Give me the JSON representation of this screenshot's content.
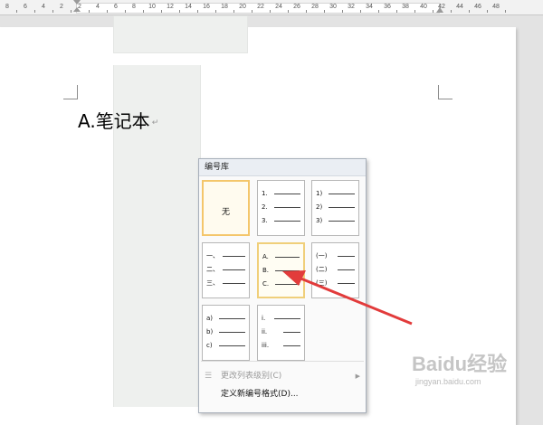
{
  "ruler": {
    "labels": [
      "8",
      "6",
      "4",
      "2",
      "2",
      "4",
      "6",
      "8",
      "10",
      "12",
      "14",
      "16",
      "18",
      "20",
      "22",
      "24",
      "26",
      "28",
      "30",
      "32",
      "34",
      "36",
      "38",
      "40",
      "42",
      "44",
      "46",
      "48"
    ]
  },
  "document": {
    "line_text": "A.笔记本",
    "paragraph_mark": "↵"
  },
  "numbering_library": {
    "title": "编号库",
    "none_label": "无",
    "styles": [
      {
        "markers": [
          "1.",
          "2.",
          "3."
        ]
      },
      {
        "markers": [
          "1)",
          "2)",
          "3)"
        ]
      },
      {
        "markers": [
          "一、",
          "二、",
          "三、"
        ]
      },
      {
        "markers": [
          "A.",
          "B.",
          "C."
        ]
      },
      {
        "markers": [
          "(一)",
          "(二)",
          "(三)"
        ]
      },
      {
        "markers": [
          "a)",
          "b)",
          "c)"
        ]
      },
      {
        "markers": [
          "i.",
          "ii.",
          "iii."
        ]
      }
    ],
    "change_level_label": "更改列表级别(C)",
    "define_new_format_label": "定义新编号格式(D)..."
  },
  "icons": {
    "change_level": "indent-list-icon",
    "submenu": "chevron-right-icon"
  },
  "colors": {
    "selected_border": "#f4c66b",
    "annotation_arrow": "#e23b3b"
  },
  "watermark": {
    "logo": "Baidu经验",
    "url": "jingyan.baidu.com"
  }
}
